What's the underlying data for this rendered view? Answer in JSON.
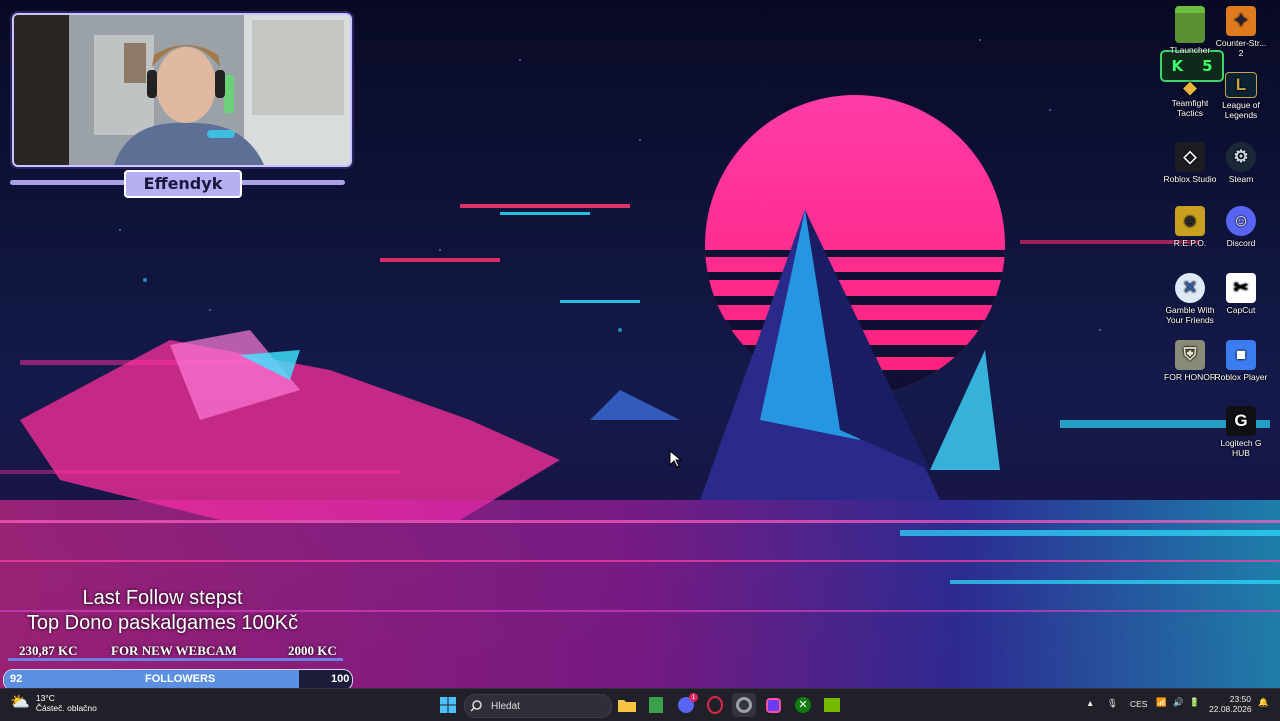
{
  "webcam": {
    "streamer_name": "Effendyk"
  },
  "stream_info": {
    "last_follow": "Last Follow stepst",
    "top_dono": "Top Dono paskalgames 100Kč"
  },
  "donation_goal": {
    "current": "230,87 KC",
    "title": "FOR NEW WEBCAM",
    "target": "2000 KC"
  },
  "followers_goal": {
    "current": "92",
    "label": "FOLLOWERS",
    "target": "100",
    "progress": 0.92
  },
  "overlay_badge": {
    "letter": "K",
    "count": "5"
  },
  "desktop_icons": [
    {
      "label": "TLauncher",
      "icon": "grass-block-icon"
    },
    {
      "label": "Counter-Str... 2",
      "icon": "counter-strike-icon"
    },
    {
      "label": "Teamfight Tactics",
      "icon": "teamfight-tactics-icon"
    },
    {
      "label": "League of Legends",
      "icon": "league-of-legends-icon"
    },
    {
      "label": "Roblox Studio",
      "icon": "roblox-studio-icon"
    },
    {
      "label": "Steam",
      "icon": "steam-icon"
    },
    {
      "label": "R.E.P.O.",
      "icon": "repo-icon"
    },
    {
      "label": "Discord",
      "icon": "discord-icon"
    },
    {
      "label": "Gamble With Your Friends",
      "icon": "gamble-icon"
    },
    {
      "label": "CapCut",
      "icon": "capcut-icon"
    },
    {
      "label": "FOR HONOR",
      "icon": "for-honor-icon"
    },
    {
      "label": "Roblox Player",
      "icon": "roblox-player-icon"
    },
    {
      "label": "Logitech G HUB",
      "icon": "logitech-ghub-icon"
    }
  ],
  "taskbar": {
    "weather_temp": "13°C",
    "weather_desc": "Částeč. oblačno",
    "search_placeholder": "Hledat",
    "language": "CES",
    "time": "23:50",
    "date": "22.08.2026",
    "discord_badge": "1"
  },
  "colors": {
    "accent_pink": "#ff2f9e",
    "accent_cyan": "#25d8ff",
    "frame_lavender": "#c9c3ff"
  }
}
